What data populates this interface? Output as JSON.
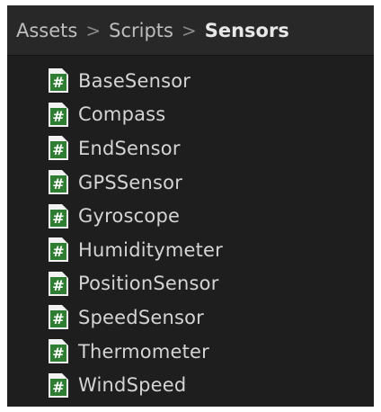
{
  "breadcrumb": {
    "items": [
      "Assets",
      "Scripts",
      "Sensors"
    ],
    "separator": ">"
  },
  "files": [
    {
      "name": "BaseSensor",
      "icon": "csharp-script-icon"
    },
    {
      "name": "Compass",
      "icon": "csharp-script-icon"
    },
    {
      "name": "EndSensor",
      "icon": "csharp-script-icon"
    },
    {
      "name": "GPSSensor",
      "icon": "csharp-script-icon"
    },
    {
      "name": "Gyroscope",
      "icon": "csharp-script-icon"
    },
    {
      "name": "Humiditymeter",
      "icon": "csharp-script-icon"
    },
    {
      "name": "PositionSensor",
      "icon": "csharp-script-icon"
    },
    {
      "name": "SpeedSensor",
      "icon": "csharp-script-icon"
    },
    {
      "name": "Thermometer",
      "icon": "csharp-script-icon"
    },
    {
      "name": "WindSpeed",
      "icon": "csharp-script-icon"
    }
  ],
  "colors": {
    "panel_bg": "#1e1e1e",
    "header_bg": "#282828",
    "icon_green": "#2f7d32",
    "icon_paper": "#f2f2f2"
  }
}
